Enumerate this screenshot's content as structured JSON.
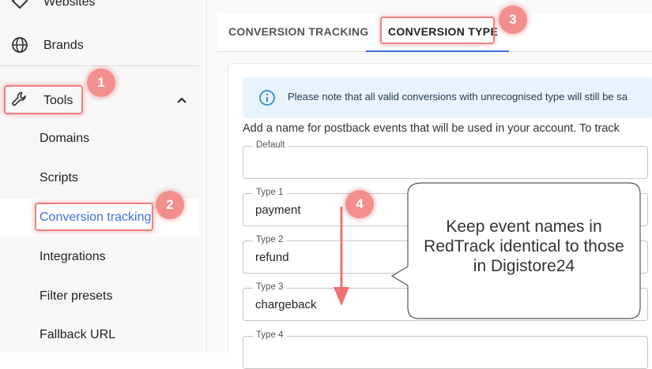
{
  "sidebar": {
    "top_item": {
      "label": "Websites",
      "icon": "tag-icon"
    },
    "brands": {
      "label": "Brands",
      "icon": "globe-icon"
    },
    "tools": {
      "label": "Tools",
      "icon": "wrench-icon",
      "chevron": "chevron-up-icon",
      "expanded": true
    },
    "sub_items": [
      "Domains",
      "Scripts",
      "Conversion tracking",
      "Integrations",
      "Filter presets",
      "Fallback URL"
    ],
    "active_item": "Conversion tracking",
    "accent_color": "#3f6fd8"
  },
  "tabs": [
    {
      "label": "CONVERSION TRACKING",
      "active": false
    },
    {
      "label": "CONVERSION TYPE",
      "active": true
    }
  ],
  "info_banner": {
    "icon": "info-icon",
    "text": "Please note that all valid conversions with unrecognised type will still be sa"
  },
  "hint_text": "Add a name for postback events that will be used in your account. To track",
  "fields": [
    {
      "label": "Default",
      "value": ""
    },
    {
      "label": "Type 1",
      "value": "payment"
    },
    {
      "label": "Type 2",
      "value": "refund"
    },
    {
      "label": "Type 3",
      "value": "chargeback"
    },
    {
      "label": "Type 4",
      "value": ""
    }
  ],
  "annotations": {
    "badges": [
      "1",
      "2",
      "3",
      "4"
    ],
    "callout": "Keep event names in RedTrack identical to those in Digistore24",
    "annotation_color": "#f28f8c"
  }
}
